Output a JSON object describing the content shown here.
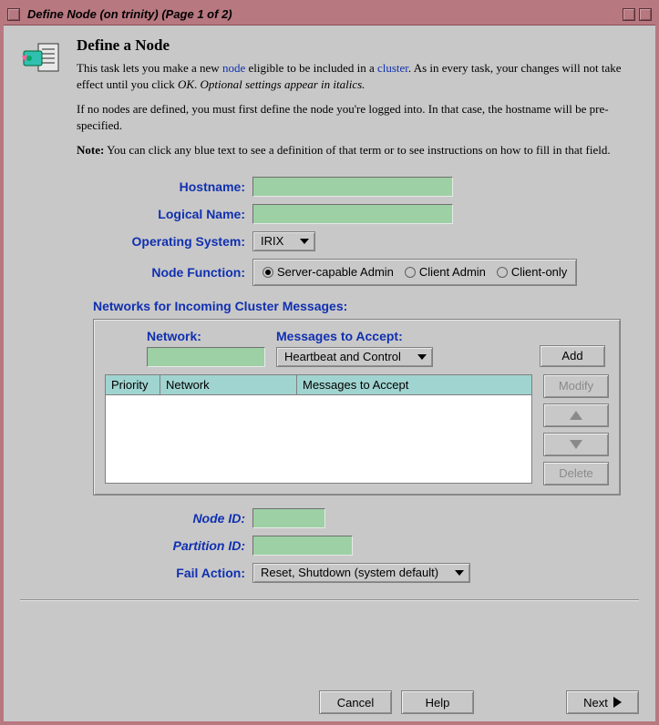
{
  "window": {
    "title": "Define Node (on trinity) (Page 1 of 2)"
  },
  "header": {
    "title": "Define a Node",
    "desc1_pre": "This task lets you make a new ",
    "desc1_link1": "node",
    "desc1_mid": " eligible to be included in a ",
    "desc1_link2": "cluster",
    "desc1_post1": ". As in every task, your changes will not take effect until you click ",
    "desc1_ok": "OK",
    "desc1_post2": ". ",
    "desc1_italic": "Optional settings appear in italics.",
    "desc2": "If no nodes are defined, you must first define the node you're logged into.  In that case, the hostname will be pre-specified.",
    "note_label": "Note:",
    "note_text": " You can click any blue text to see a definition of that term or to see instructions on how to fill in that field."
  },
  "form": {
    "hostname_label": "Hostname:",
    "hostname_value": "",
    "logical_label": "Logical Name:",
    "logical_value": "",
    "os_label": "Operating System:",
    "os_value": "IRIX",
    "nodefn_label": "Node Function:",
    "nodefn_options": {
      "opt1": "Server-capable Admin",
      "opt2": "Client Admin",
      "opt3": "Client-only"
    },
    "nodeid_label": "Node ID:",
    "nodeid_value": "",
    "partition_label": "Partition ID:",
    "partition_value": "",
    "fail_label": "Fail Action:",
    "fail_value": "Reset, Shutdown (system default)"
  },
  "networks": {
    "section_label": "Networks for Incoming Cluster Messages:",
    "network_head": "Network:",
    "network_value": "",
    "messages_head": "Messages to Accept:",
    "messages_value": "Heartbeat and Control",
    "add_label": "Add",
    "modify_label": "Modify",
    "delete_label": "Delete",
    "columns": {
      "priority": "Priority",
      "network": "Network",
      "messages": "Messages to Accept"
    }
  },
  "footer": {
    "cancel": "Cancel",
    "help": "Help",
    "next": "Next"
  }
}
